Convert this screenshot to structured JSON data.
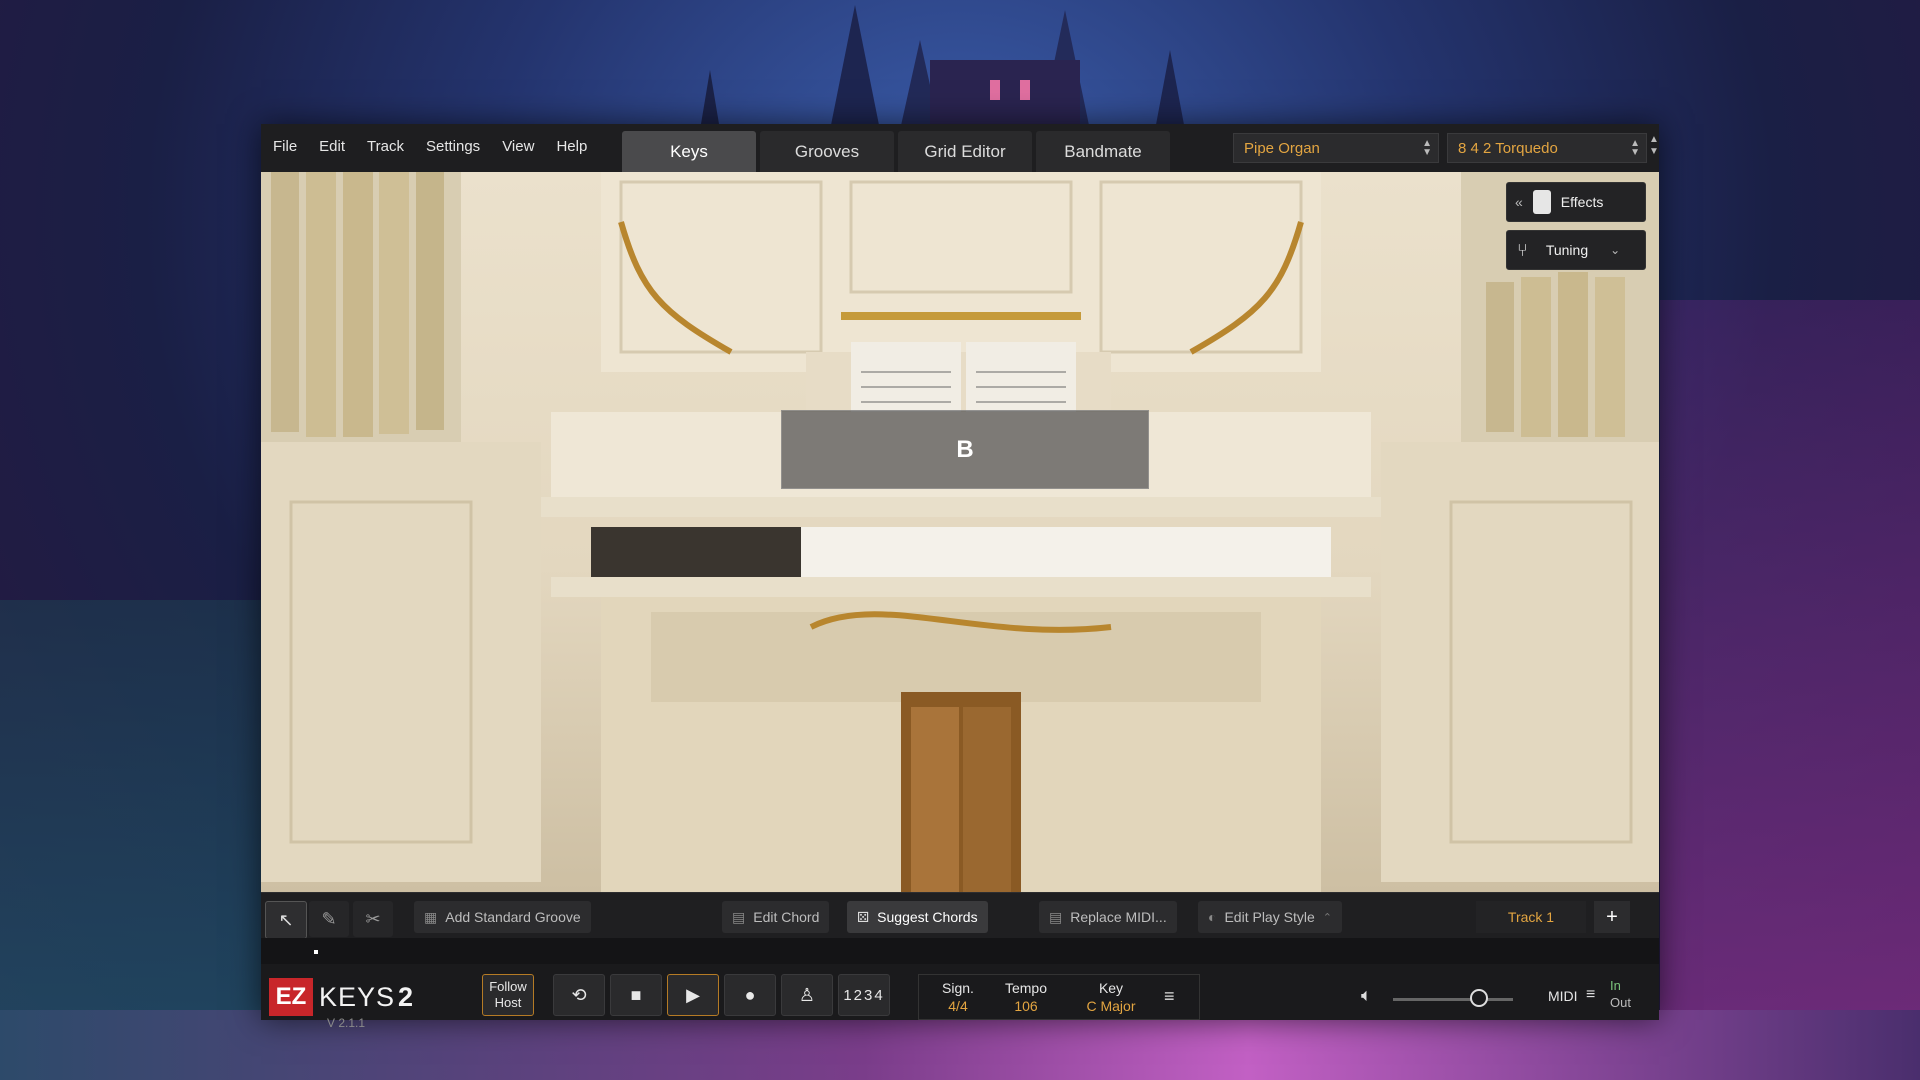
{
  "menu": [
    "File",
    "Edit",
    "Track",
    "Settings",
    "View",
    "Help"
  ],
  "tabs": [
    {
      "label": "Keys",
      "active": true
    },
    {
      "label": "Grooves",
      "active": false
    },
    {
      "label": "Grid Editor",
      "active": false
    },
    {
      "label": "Bandmate",
      "active": false
    }
  ],
  "instrument_preset": "Pipe Organ",
  "sound_preset": "8 4 2 Torquedo",
  "chord_display": "B",
  "side_panel": {
    "effects_label": "Effects",
    "tuning_label": "Tuning"
  },
  "toolbar": {
    "add_groove": "Add Standard Groove",
    "edit_chord": "Edit Chord",
    "suggest_chords": "Suggest Chords",
    "replace_midi": "Replace MIDI...",
    "edit_play_style": "Edit Play Style",
    "track_name": "Track 1",
    "add_track": "+"
  },
  "transport": {
    "logo_ez": "EZ",
    "logo_keys": "KEYS",
    "logo_num": "2",
    "version": "V 2.1.1",
    "follow_host": "Follow Host",
    "count_in": "1234",
    "sign_label": "Sign.",
    "sign_value": "4/4",
    "tempo_label": "Tempo",
    "tempo_value": "106",
    "key_label": "Key",
    "key_value": "C Major",
    "midi_label": "MIDI",
    "midi_in": "In",
    "midi_out": "Out",
    "volume_level": 0.72
  },
  "colors": {
    "accent": "#e3a541",
    "logo_red": "#c8262a"
  }
}
